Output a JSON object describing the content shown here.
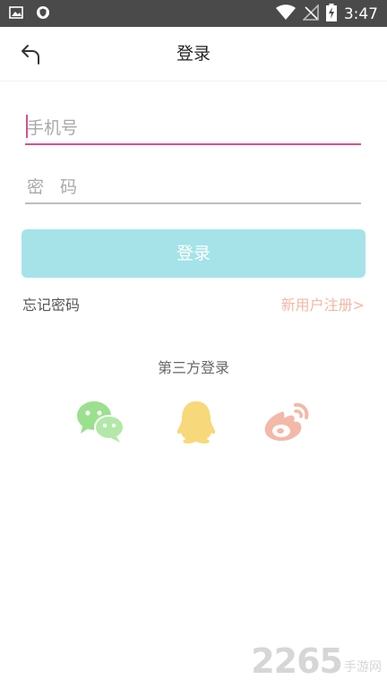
{
  "status_bar": {
    "time": "3:47",
    "icons": [
      "image-icon",
      "shield-icon",
      "wifi-icon",
      "no-signal-icon",
      "battery-charging-icon"
    ]
  },
  "header": {
    "title": "登录",
    "back_icon": "back-arrow-icon"
  },
  "form": {
    "phone_placeholder": "手机号",
    "password_placeholder": "密码",
    "login_button": "登录"
  },
  "links": {
    "forgot_password": "忘记密码",
    "register": "新用户注册>"
  },
  "third_party": {
    "label": "第三方登录",
    "providers": [
      "wechat-icon",
      "qq-icon",
      "weibo-icon"
    ]
  },
  "watermark": {
    "number": "2265",
    "text": "手游网"
  },
  "colors": {
    "accent_pink": "#d9508b",
    "button_teal": "#a5e3e8",
    "register_link": "#f3b8a3",
    "wechat_green": "#9be08f",
    "qq_yellow": "#f7d87a",
    "weibo_peach": "#f4b8a8"
  }
}
